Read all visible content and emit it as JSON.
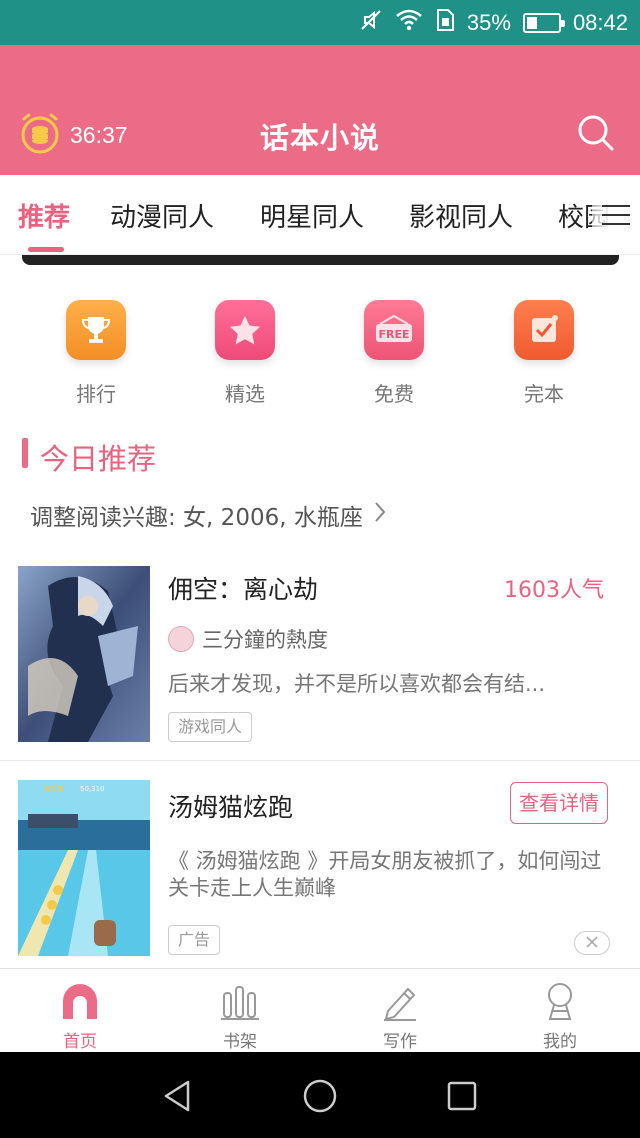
{
  "status_bar": {
    "battery": "35%",
    "battery_level": 0.35,
    "time": "08:42"
  },
  "header": {
    "timer": "36:37",
    "title": "话本小说"
  },
  "tabs": [
    {
      "label": "推荐",
      "active": true
    },
    {
      "label": "动漫同人",
      "active": false
    },
    {
      "label": "明星同人",
      "active": false
    },
    {
      "label": "影视同人",
      "active": false
    },
    {
      "label": "校园",
      "active": false
    }
  ],
  "quick_links": [
    {
      "label": "排行",
      "icon": "trophy-icon",
      "color": "#f7a23a"
    },
    {
      "label": "精选",
      "icon": "star-icon",
      "color": "#f25b86"
    },
    {
      "label": "免费",
      "icon": "free-icon",
      "color": "#f0607f"
    },
    {
      "label": "完本",
      "icon": "check-icon",
      "color": "#f26b3e"
    }
  ],
  "section": {
    "title": "今日推荐",
    "interest": "调整阅读兴趣: 女, 2006, 水瓶座"
  },
  "books": [
    {
      "title": "佣空：离心劫",
      "popularity": "1603人气",
      "author": "三分鐘的熱度",
      "description": "后来才发现，并不是所以喜欢都会有结...",
      "tag": "游戏同人"
    }
  ],
  "ad": {
    "title": "汤姆猫炫跑",
    "button": "查看详情",
    "description": "《 汤姆猫炫跑 》开局女朋友被抓了，如何闯过关卡走上人生巅峰",
    "tag": "广告",
    "cover_badges": [
      "X15",
      "50,310"
    ]
  },
  "bottom_nav": [
    {
      "label": "首页",
      "active": true
    },
    {
      "label": "书架",
      "active": false
    },
    {
      "label": "写作",
      "active": false
    },
    {
      "label": "我的",
      "active": false
    }
  ],
  "colors": {
    "status_bar": "#1f9186",
    "header": "#ec6c88",
    "accent": "#e8637f"
  }
}
